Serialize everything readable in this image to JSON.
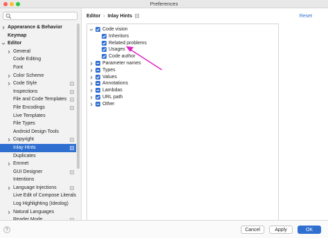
{
  "window": {
    "title": "Preferences"
  },
  "colors": {
    "accent": "#2f6fd0",
    "annotation": "#e020c0"
  },
  "sidebar": {
    "search_placeholder": "",
    "items": [
      {
        "label": "Appearance & Behavior",
        "level": 0,
        "expandable": true,
        "selected": false,
        "project": false
      },
      {
        "label": "Keymap",
        "level": 0,
        "expandable": false,
        "selected": false,
        "project": false
      },
      {
        "label": "Editor",
        "level": 0,
        "expandable": true,
        "expanded": true,
        "selected": false,
        "project": false
      },
      {
        "label": "General",
        "level": 1,
        "expandable": true,
        "selected": false,
        "project": false
      },
      {
        "label": "Code Editing",
        "level": 1,
        "expandable": false,
        "selected": false,
        "project": false
      },
      {
        "label": "Font",
        "level": 1,
        "expandable": false,
        "selected": false,
        "project": false
      },
      {
        "label": "Color Scheme",
        "level": 1,
        "expandable": true,
        "selected": false,
        "project": false
      },
      {
        "label": "Code Style",
        "level": 1,
        "expandable": true,
        "selected": false,
        "project": true
      },
      {
        "label": "Inspections",
        "level": 1,
        "expandable": false,
        "selected": false,
        "project": true
      },
      {
        "label": "File and Code Templates",
        "level": 1,
        "expandable": false,
        "selected": false,
        "project": true
      },
      {
        "label": "File Encodings",
        "level": 1,
        "expandable": false,
        "selected": false,
        "project": true
      },
      {
        "label": "Live Templates",
        "level": 1,
        "expandable": false,
        "selected": false,
        "project": false
      },
      {
        "label": "File Types",
        "level": 1,
        "expandable": false,
        "selected": false,
        "project": false
      },
      {
        "label": "Android Design Tools",
        "level": 1,
        "expandable": false,
        "selected": false,
        "project": false
      },
      {
        "label": "Copyright",
        "level": 1,
        "expandable": true,
        "selected": false,
        "project": true
      },
      {
        "label": "Inlay Hints",
        "level": 1,
        "expandable": false,
        "selected": true,
        "project": true
      },
      {
        "label": "Duplicates",
        "level": 1,
        "expandable": false,
        "selected": false,
        "project": false
      },
      {
        "label": "Emmet",
        "level": 1,
        "expandable": true,
        "selected": false,
        "project": false
      },
      {
        "label": "GUI Designer",
        "level": 1,
        "expandable": false,
        "selected": false,
        "project": true
      },
      {
        "label": "Intentions",
        "level": 1,
        "expandable": false,
        "selected": false,
        "project": false
      },
      {
        "label": "Language Injections",
        "level": 1,
        "expandable": true,
        "selected": false,
        "project": true
      },
      {
        "label": "Live Edit of Compose Literals",
        "level": 1,
        "expandable": false,
        "selected": false,
        "project": false
      },
      {
        "label": "Log Highlighting (Ideolog)",
        "level": 1,
        "expandable": false,
        "selected": false,
        "project": false
      },
      {
        "label": "Natural Languages",
        "level": 1,
        "expandable": true,
        "selected": false,
        "project": false
      },
      {
        "label": "Reader Mode",
        "level": 1,
        "expandable": false,
        "selected": false,
        "project": true
      }
    ]
  },
  "breadcrumb": {
    "parent": "Editor",
    "separator": "›",
    "current": "Inlay Hints"
  },
  "reset_label": "Reset",
  "hints": [
    {
      "label": "Code vision",
      "level": 0,
      "expandable": true,
      "expanded": true,
      "state": "checked"
    },
    {
      "label": "Inheritors",
      "level": 1,
      "expandable": false,
      "state": "checked"
    },
    {
      "label": "Related problems",
      "level": 1,
      "expandable": false,
      "state": "checked"
    },
    {
      "label": "Usages",
      "level": 1,
      "expandable": false,
      "state": "checked"
    },
    {
      "label": "Code author",
      "level": 1,
      "expandable": false,
      "state": "checked"
    },
    {
      "label": "Parameter names",
      "level": 0,
      "expandable": true,
      "expanded": false,
      "state": "partial"
    },
    {
      "label": "Types",
      "level": 0,
      "expandable": true,
      "expanded": false,
      "state": "partial"
    },
    {
      "label": "Values",
      "level": 0,
      "expandable": true,
      "expanded": false,
      "state": "checked"
    },
    {
      "label": "Annotations",
      "level": 0,
      "expandable": true,
      "expanded": false,
      "state": "partial"
    },
    {
      "label": "Lambdas",
      "level": 0,
      "expandable": true,
      "expanded": false,
      "state": "partial"
    },
    {
      "label": "URL path",
      "level": 0,
      "expandable": true,
      "expanded": false,
      "state": "checked"
    },
    {
      "label": "Other",
      "level": 0,
      "expandable": true,
      "expanded": false,
      "state": "partial"
    }
  ],
  "footer": {
    "help_label": "?",
    "cancel_label": "Cancel",
    "apply_label": "Apply",
    "ok_label": "OK"
  }
}
